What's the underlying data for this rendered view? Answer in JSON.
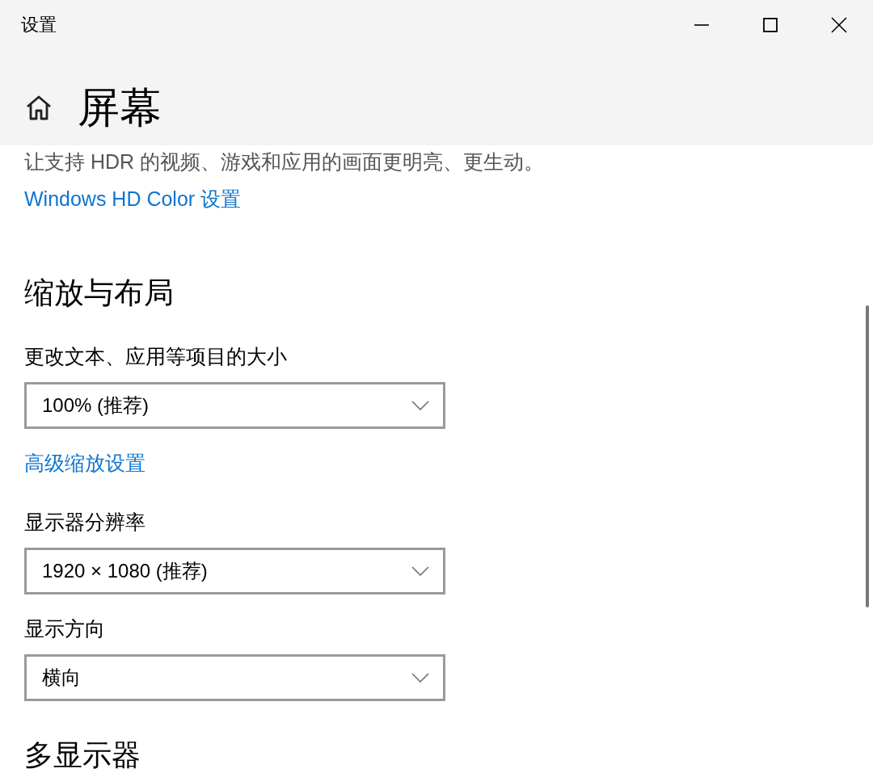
{
  "window": {
    "title": "设置"
  },
  "page": {
    "title": "屏幕"
  },
  "hdr": {
    "description": "让支持 HDR 的视频、游戏和应用的画面更明亮、更生动。",
    "link": "Windows HD Color 设置"
  },
  "scale_and_layout": {
    "heading": "缩放与布局",
    "items": [
      {
        "kind": "dropdown",
        "label": "更改文本、应用等项目的大小",
        "value": "100% (推荐)"
      },
      {
        "kind": "link",
        "text": "高级缩放设置"
      },
      {
        "kind": "dropdown",
        "label": "显示器分辨率",
        "value": "1920 × 1080 (推荐)"
      },
      {
        "kind": "dropdown",
        "label": "显示方向",
        "value": "横向"
      }
    ]
  },
  "multiple_displays": {
    "heading": "多显示器"
  }
}
